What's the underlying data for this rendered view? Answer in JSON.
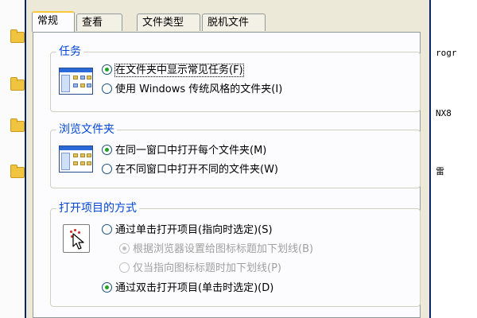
{
  "dialog": {
    "tabs": [
      {
        "label": "常规",
        "active": true
      },
      {
        "label": "查看",
        "active": false
      },
      {
        "label": "文件类型",
        "active": false
      },
      {
        "label": "脱机文件",
        "active": false
      }
    ],
    "groups": {
      "tasks": {
        "title": "任务",
        "options": [
          {
            "label": "在文件夹中显示常见任务(F)",
            "checked": true,
            "enabled": true
          },
          {
            "label": "使用 Windows 传统风格的文件夹(I)",
            "checked": false,
            "enabled": true
          }
        ]
      },
      "browse": {
        "title": "浏览文件夹",
        "options": [
          {
            "label": "在同一窗口中打开每个文件夹(M)",
            "checked": true,
            "enabled": true
          },
          {
            "label": "在不同窗口中打开不同的文件夹(W)",
            "checked": false,
            "enabled": true
          }
        ]
      },
      "click": {
        "title": "打开项目的方式",
        "options": [
          {
            "label": "通过单击打开项目(指向时选定)(S)",
            "checked": false,
            "enabled": true
          },
          {
            "label": "根据浏览器设置给图标标题加下划线(B)",
            "checked": true,
            "enabled": false
          },
          {
            "label": "仅当指向图标标题时加下划线(P)",
            "checked": false,
            "enabled": false
          },
          {
            "label": "通过双击打开项目(单击时选定)(D)",
            "checked": true,
            "enabled": true
          }
        ]
      }
    }
  },
  "background": {
    "right_texts": [
      "rogr",
      "NX8",
      "雷"
    ]
  },
  "colors": {
    "group_title": "#0046d5",
    "dialog_bg": "#ece9d8",
    "panel_bg": "#fcfcfe",
    "radio_dot": "#21a121",
    "active_tab_accent": "#ffc83c"
  },
  "icons": {
    "tasks_illustration": "window-with-task-pane-icon",
    "browse_illustration": "window-icon",
    "click_illustration": "click-cursor-icon",
    "background_folder": "folder-icon"
  }
}
